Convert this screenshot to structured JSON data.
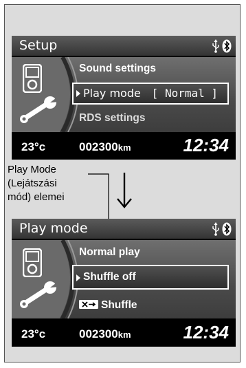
{
  "top_screen": {
    "title": "Setup",
    "items": [
      {
        "label": "Sound settings"
      },
      {
        "label": "Play mode",
        "value": "[ Normal ]"
      },
      {
        "label": "RDS settings"
      }
    ],
    "temperature": "23°c",
    "odometer": "002300",
    "odometer_unit": "km",
    "clock": "12:34"
  },
  "annotation": {
    "text_line1": "Play Mode",
    "text_line2": "(Lejátszási",
    "text_line3": "mód) elemei"
  },
  "bottom_screen": {
    "title": "Play mode",
    "items": [
      {
        "label": "Normal play"
      },
      {
        "label": "Shuffle off"
      },
      {
        "label": "Shuffle",
        "badge_icon": "shuffle-icon"
      }
    ],
    "temperature": "23°c",
    "odometer": "002300",
    "odometer_unit": "km",
    "clock": "12:34"
  },
  "icons": {
    "usb": "usb-icon",
    "bluetooth": "bluetooth-icon",
    "media_player": "media-player-icon",
    "wrench": "wrench-icon"
  },
  "colors": {
    "screen_bg": "#000000",
    "page_bg": "#dcdcdc",
    "text": "#ffffff"
  }
}
